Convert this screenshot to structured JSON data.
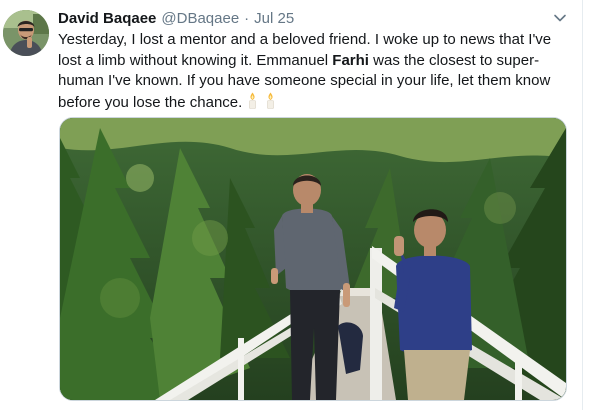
{
  "tweet": {
    "display_name": "David Baqaee",
    "handle": "@DBaqaee",
    "separator": "·",
    "date": "Jul 25",
    "text_part1": "Yesterday, I lost a mentor and a beloved friend. I woke up to news that I've lost a limb without knowing it. Emmanuel ",
    "text_bold": "Farhi",
    "text_part2": " was the closest to super-human I've known. If you have someone special in your life, let them know before you lose the chance.",
    "emojis": [
      "candle-emoji",
      "candle-emoji"
    ]
  },
  "icons": {
    "caret": "chevron-down-icon",
    "avatar": "avatar"
  },
  "colors": {
    "name": "#14171a",
    "secondary": "#657786",
    "border": "#ccd6dd"
  }
}
